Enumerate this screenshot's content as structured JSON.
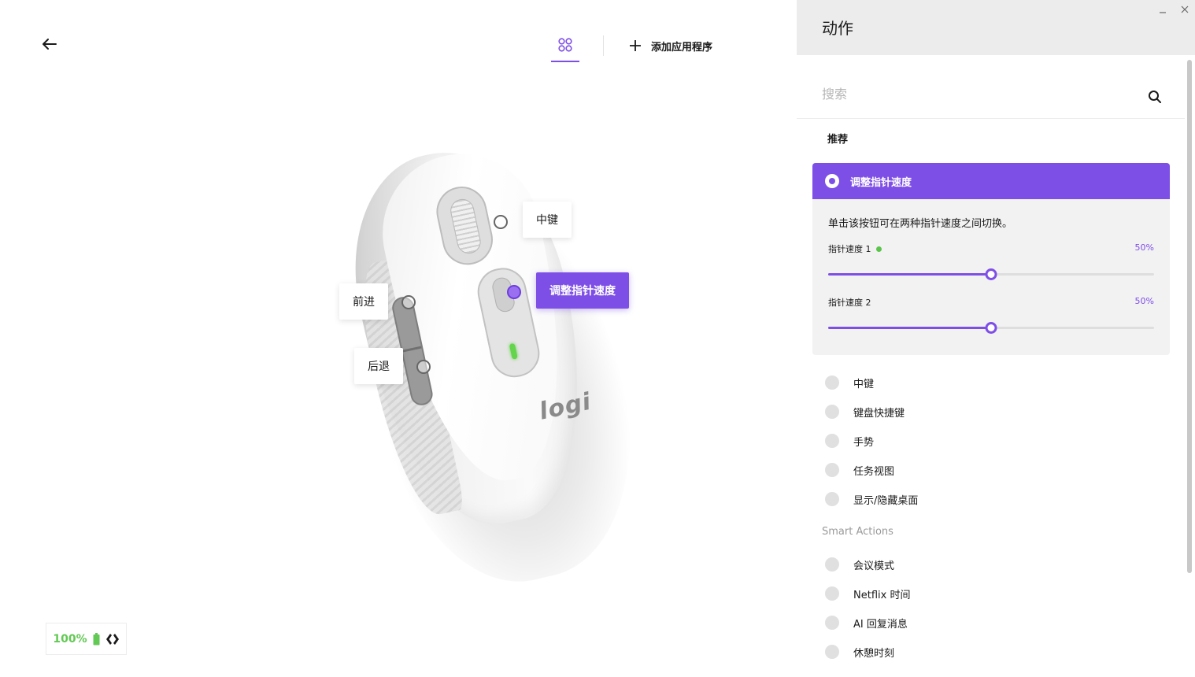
{
  "app_bar": {
    "add_app_label": "添加应用程序"
  },
  "mouse": {
    "logo_text": "logi",
    "callouts": {
      "middle": "中键",
      "forward": "前进",
      "back": "后退",
      "dpi": "调整指针速度"
    }
  },
  "battery": {
    "percent": "100%"
  },
  "panel": {
    "title": "动作",
    "search_placeholder": "搜索",
    "recommended_label": "推荐",
    "selected": {
      "title": "调整指针速度",
      "description": "单击该按钮可在两种指针速度之间切换。",
      "speed1_label": "指针速度 1",
      "speed1_value": "50%",
      "speed1_fraction": 0.5,
      "speed2_label": "指针速度 2",
      "speed2_value": "50%",
      "speed2_fraction": 0.5
    },
    "actions": [
      "中键",
      "键盘快捷键",
      "手势",
      "任务视图",
      "显示/隐藏桌面"
    ],
    "smart_actions_label": "Smart Actions",
    "smart_actions": [
      "会议模式",
      "Netflix 时间",
      "AI 回复消息",
      "休憩时刻"
    ]
  },
  "colors": {
    "accent": "#7e4fe6",
    "battery_green": "#62c954",
    "led_green": "#63d44b"
  },
  "icons": [
    "back-arrow-icon",
    "grid-apps-icon",
    "plus-icon",
    "minimize-icon",
    "close-icon",
    "search-icon",
    "battery-icon",
    "bolt-connection-icon"
  ]
}
